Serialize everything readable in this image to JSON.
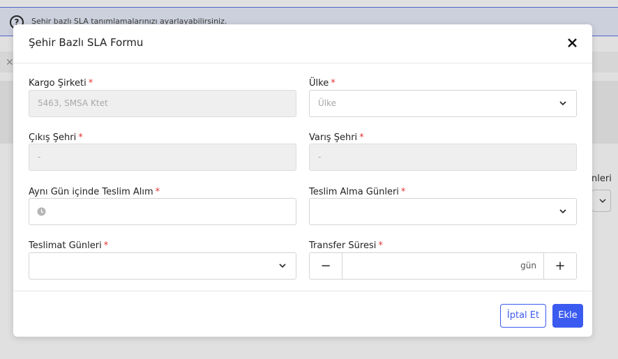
{
  "background": {
    "info_text": "Şehir bazlı SLA tanımlamalarınızı ayarlayabilirsiniz.",
    "info_icon": "question-icon",
    "side_label": "nleri",
    "side_select_value": "v"
  },
  "modal": {
    "title": "Şehir Bazlı SLA Formu",
    "close_icon": "close-icon",
    "fields": {
      "cargo_company": {
        "label": "Kargo Şirketi",
        "required": "*",
        "value": "5463, SMSA Ktet"
      },
      "country": {
        "label": "Ülke",
        "required": "*",
        "placeholder": "Ülke"
      },
      "departure_city": {
        "label": "Çıkış Şehri",
        "required": "*",
        "value": "-"
      },
      "arrival_city": {
        "label": "Varış Şehri",
        "required": "*",
        "value": "-"
      },
      "same_day_pickup": {
        "label": "Aynı Gün içinde Teslim Alım",
        "required": "*",
        "value": ""
      },
      "pickup_days": {
        "label": "Teslim Alma Günleri",
        "required": "*",
        "value": ""
      },
      "delivery_days": {
        "label": "Teslimat Günleri",
        "required": "*",
        "value": ""
      },
      "transfer_time": {
        "label": "Transfer Süresi",
        "required": "*",
        "value": "",
        "unit": "gün",
        "minus": "−",
        "plus": "+"
      }
    },
    "footer": {
      "cancel_label": "İptal Et",
      "add_label": "Ekle"
    }
  },
  "colors": {
    "primary": "#3b5bf0",
    "required": "#e23232",
    "info_bg": "#e9edfb"
  }
}
